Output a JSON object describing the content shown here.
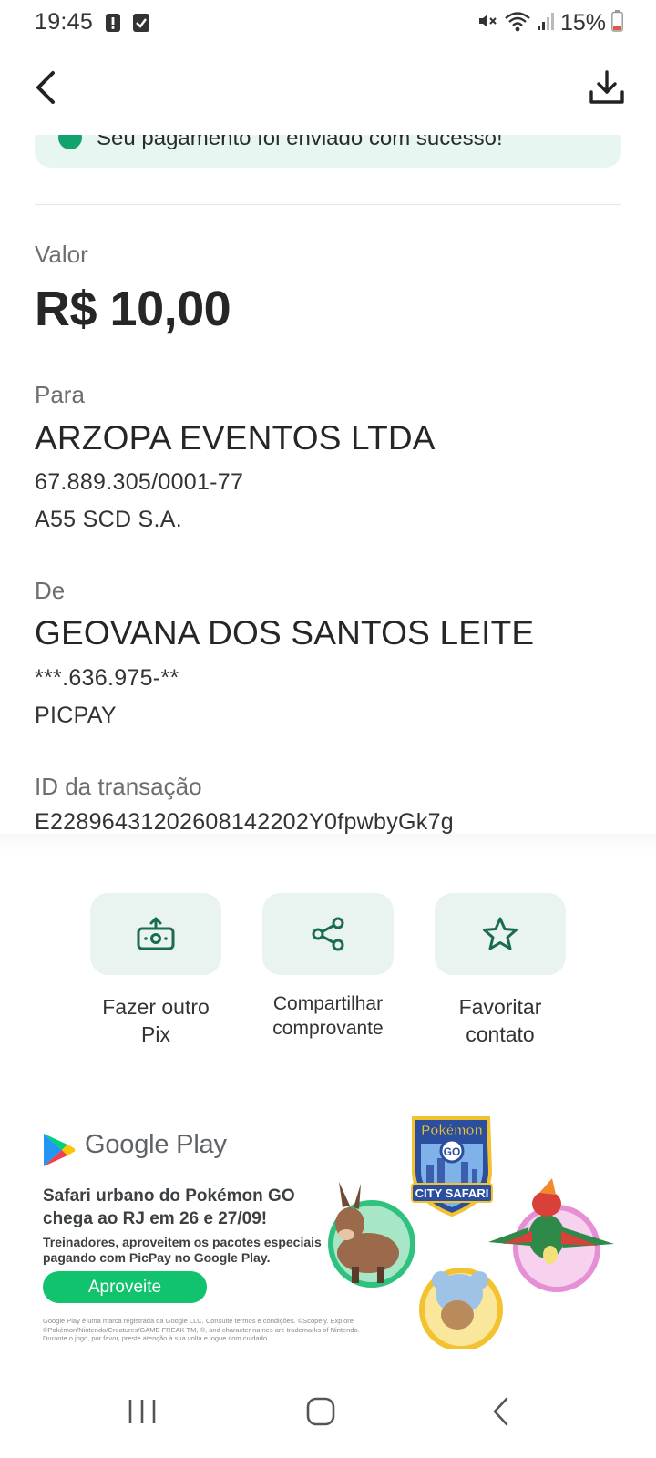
{
  "status_bar": {
    "time": "19:45",
    "battery": "15%",
    "icons": [
      "alert-icon",
      "checkbox-icon",
      "mute-icon",
      "wifi-icon",
      "signal-icon",
      "battery-icon"
    ]
  },
  "header": {
    "back_icon": "back-arrow-icon",
    "download_icon": "download-icon"
  },
  "banner": {
    "text": "Seu pagamento foi enviado com sucesso!"
  },
  "receipt": {
    "valor_label": "Valor",
    "valor": "R$ 10,00",
    "para_label": "Para",
    "para_nome": "ARZOPA EVENTOS LTDA",
    "para_doc": "67.889.305/0001-77",
    "para_banco": "A55 SCD S.A.",
    "de_label": "De",
    "de_nome": "GEOVANA DOS SANTOS LEITE",
    "de_doc": "***.636.975-**",
    "de_banco": "PICPAY",
    "id_label": "ID da transação",
    "id_value": "E22896431202608142202Y0fpwbyGk7g"
  },
  "actions": [
    {
      "label": "Fazer outro Pix",
      "icon": "pix-transfer-icon"
    },
    {
      "label": "Compartilhar comprovante",
      "icon": "share-icon"
    },
    {
      "label": "Favoritar contato",
      "icon": "star-icon"
    }
  ],
  "ad": {
    "brand": "Google Play",
    "headline": "Safari urbano do Pokémon GO chega ao RJ em 26 e 27/09!",
    "body": "Treinadores, aproveitem os pacotes especiais pagando com PicPay no Google Play.",
    "cta": "Aproveite",
    "legal": "Google Play é uma marca registrada da Google LLC. Consulte termos e condições. ©Scopely. Explore ©Pokémon/Nintendo/Creatures/GAME FREAK TM, ®, and character names are trademarks of Nintendo. Durante o jogo, por favor, preste atenção à sua volta e jogue com cuidado.",
    "badge_line1": "Pokémon",
    "badge_line2": "GO",
    "badge_ribbon": "CITY SAFARI"
  },
  "nav_bar": {
    "icons": [
      "recents-icon",
      "home-icon",
      "back-icon"
    ]
  },
  "colors": {
    "accent": "#11a36b",
    "tile_bg": "#e9f3ef",
    "banner_bg": "#e7f6f0",
    "cta_green": "#11c36d"
  }
}
